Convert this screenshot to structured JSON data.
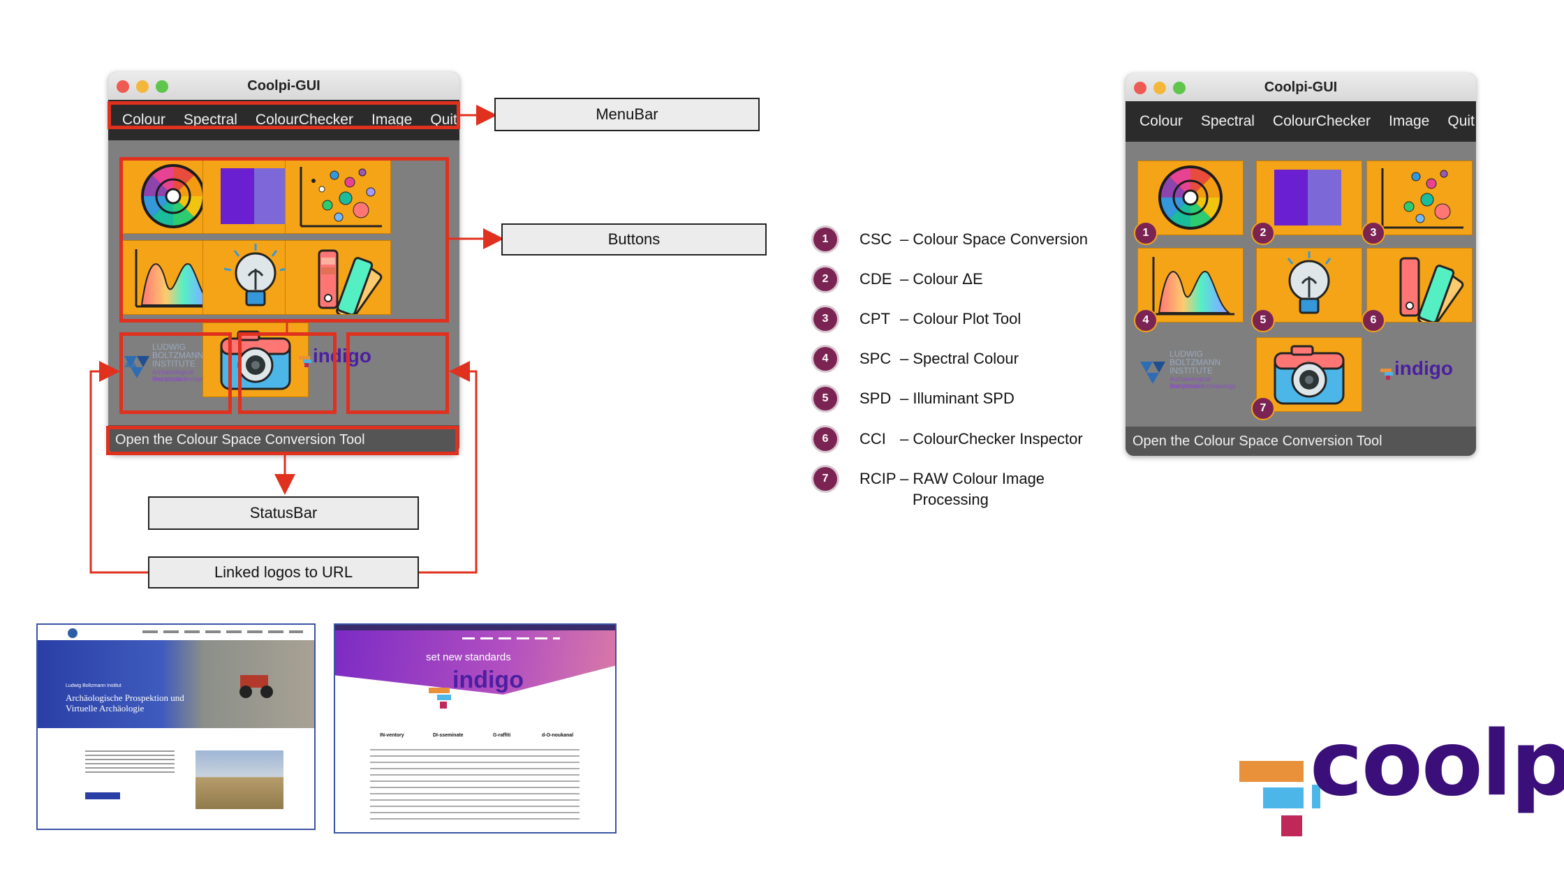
{
  "window": {
    "title": "Coolpi-GUI",
    "menu": [
      "Colour",
      "Spectral",
      "ColourChecker",
      "Image",
      "Quit"
    ],
    "status_text": "Open the Colour Space Conversion Tool",
    "lbi_logo_lines": [
      "LUDWIG",
      "BOLTZMANN",
      "INSTITUTE",
      "Archaeological Prospection",
      "and Virtual Archaeology"
    ],
    "indigo_logo_text": "indigo"
  },
  "annotations": {
    "menubar": "MenuBar",
    "buttons": "Buttons",
    "statusbar": "StatusBar",
    "linked_logos": "Linked logos to URL"
  },
  "legend": [
    {
      "num": "1",
      "abbr": "CSC",
      "desc": "– Colour Space Conversion"
    },
    {
      "num": "2",
      "abbr": "CDE",
      "desc": "– Colour ΔE"
    },
    {
      "num": "3",
      "abbr": "CPT",
      "desc": "– Colour Plot Tool"
    },
    {
      "num": "4",
      "abbr": "SPC",
      "desc": "– Spectral Colour"
    },
    {
      "num": "5",
      "abbr": "SPD",
      "desc": "– Illuminant SPD"
    },
    {
      "num": "6",
      "abbr": "CCI",
      "desc": "– ColourChecker Inspector"
    },
    {
      "num": "7",
      "abbr": "RCIP",
      "desc": "– RAW Colour Image",
      "desc2": "Processing"
    }
  ],
  "badges": [
    "1",
    "2",
    "3",
    "4",
    "5",
    "6",
    "7"
  ],
  "lbi_site": {
    "subtitle": "Ludwig Boltzmann Institut",
    "heading_line1": "Archäologische Prospektion und",
    "heading_line2": "Virtuelle Archäologie"
  },
  "indigo_site": {
    "tagline": "set new standards",
    "logo_text": "indigo",
    "features": [
      "IN-ventory",
      "DI-sseminate",
      "G-raffiti",
      "d-O-noukanal"
    ]
  },
  "brand": {
    "coolpi_text": "coolpi",
    "colors": {
      "accent": "#e0301e",
      "tile": "#f5a418",
      "badge": "#7b2453",
      "coolpi": "#3b0f7a"
    }
  }
}
